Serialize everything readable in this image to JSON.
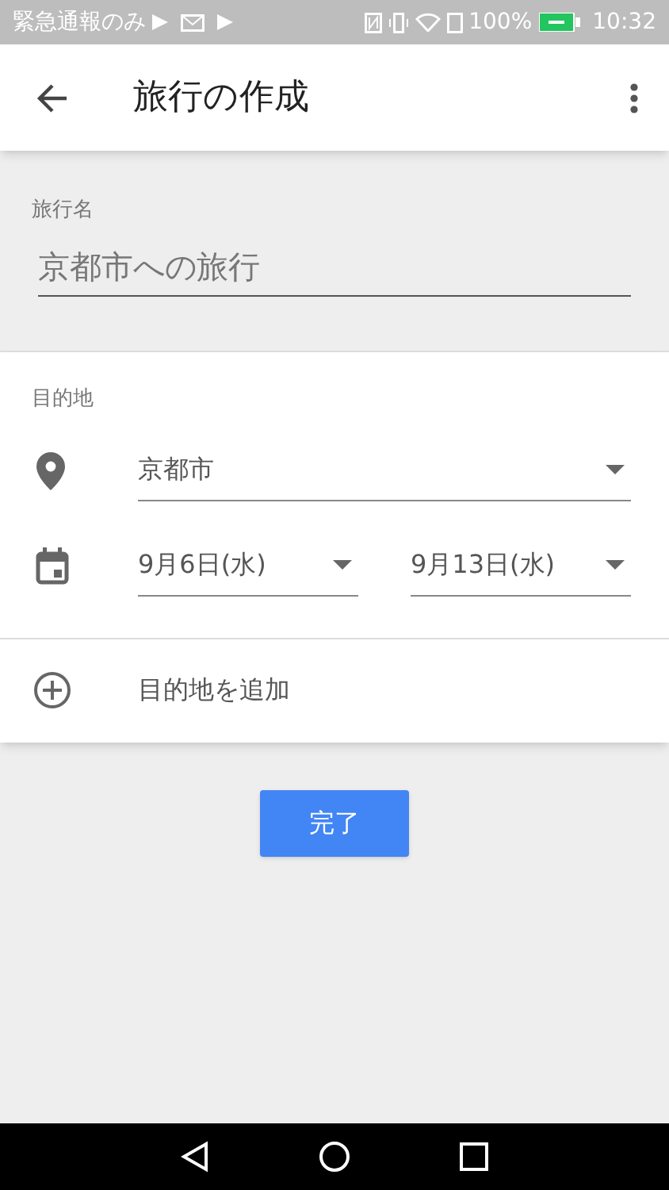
{
  "status_bar": {
    "carrier": "緊急通報のみ",
    "battery": "100%",
    "time": "10:32"
  },
  "app_bar": {
    "title": "旅行の作成"
  },
  "trip_name": {
    "label": "旅行名",
    "value": "京都市への旅行"
  },
  "destination": {
    "label": "目的地",
    "place": "京都市",
    "start_date": "9月6日(水)",
    "end_date": "9月13日(水)"
  },
  "add_destination": {
    "label": "目的地を追加"
  },
  "done_button": {
    "label": "完了"
  }
}
